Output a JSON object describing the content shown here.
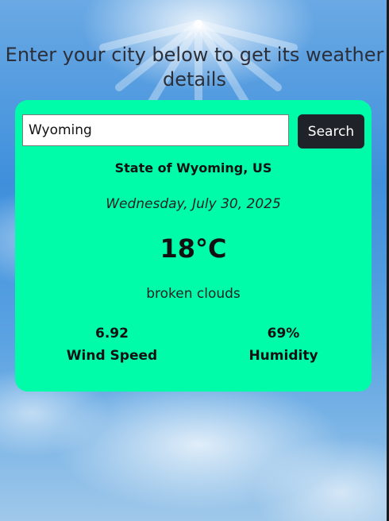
{
  "page": {
    "title": "Enter your city below to get its weather details"
  },
  "search": {
    "value": "Wyoming",
    "button_label": "Search"
  },
  "weather": {
    "location": "State of Wyoming, US",
    "date": "Wednesday, July 30, 2025",
    "temperature": "18°C",
    "description": "broken clouds",
    "wind_speed_value": "6.92",
    "wind_speed_label": "Wind Speed",
    "humidity_value": "69%",
    "humidity_label": "Humidity"
  },
  "colors": {
    "card_background": "#00fca8",
    "button_background": "#1f2229",
    "title_text": "#2b2f3a"
  }
}
